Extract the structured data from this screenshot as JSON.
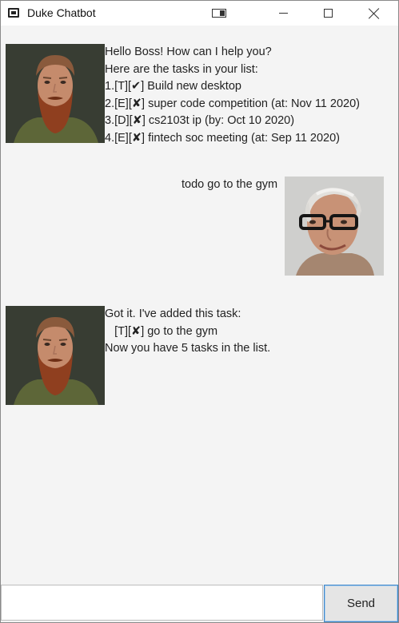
{
  "window": {
    "title": "Duke Chatbot"
  },
  "dialog": {
    "greeting": {
      "line1": "Hello Boss! How can I help you?",
      "line2": "Here are the tasks in your list:",
      "tasks": [
        {
          "prefix": "1.[T][",
          "mark": "✔",
          "text": "] Build new desktop"
        },
        {
          "prefix": "2.[E][",
          "mark": "✘",
          "text": "] super code competition (at: Nov 11 2020)"
        },
        {
          "prefix": "3.[D][",
          "mark": "✘",
          "text": "] cs2103t ip (by: Oct 10 2020)"
        },
        {
          "prefix": "4.[E][",
          "mark": "✘",
          "text": "] fintech soc meeting (at: Sep 11 2020)"
        }
      ]
    },
    "user_message": "todo go to the gym",
    "reply": {
      "line1": "Got it. I've added this task:",
      "task_prefix": "   [T][",
      "task_mark": "✘",
      "task_text": "] go to the gym",
      "line3": "Now you have 5 tasks in the list."
    }
  },
  "input": {
    "value": "",
    "placeholder": ""
  },
  "send_label": "Send"
}
